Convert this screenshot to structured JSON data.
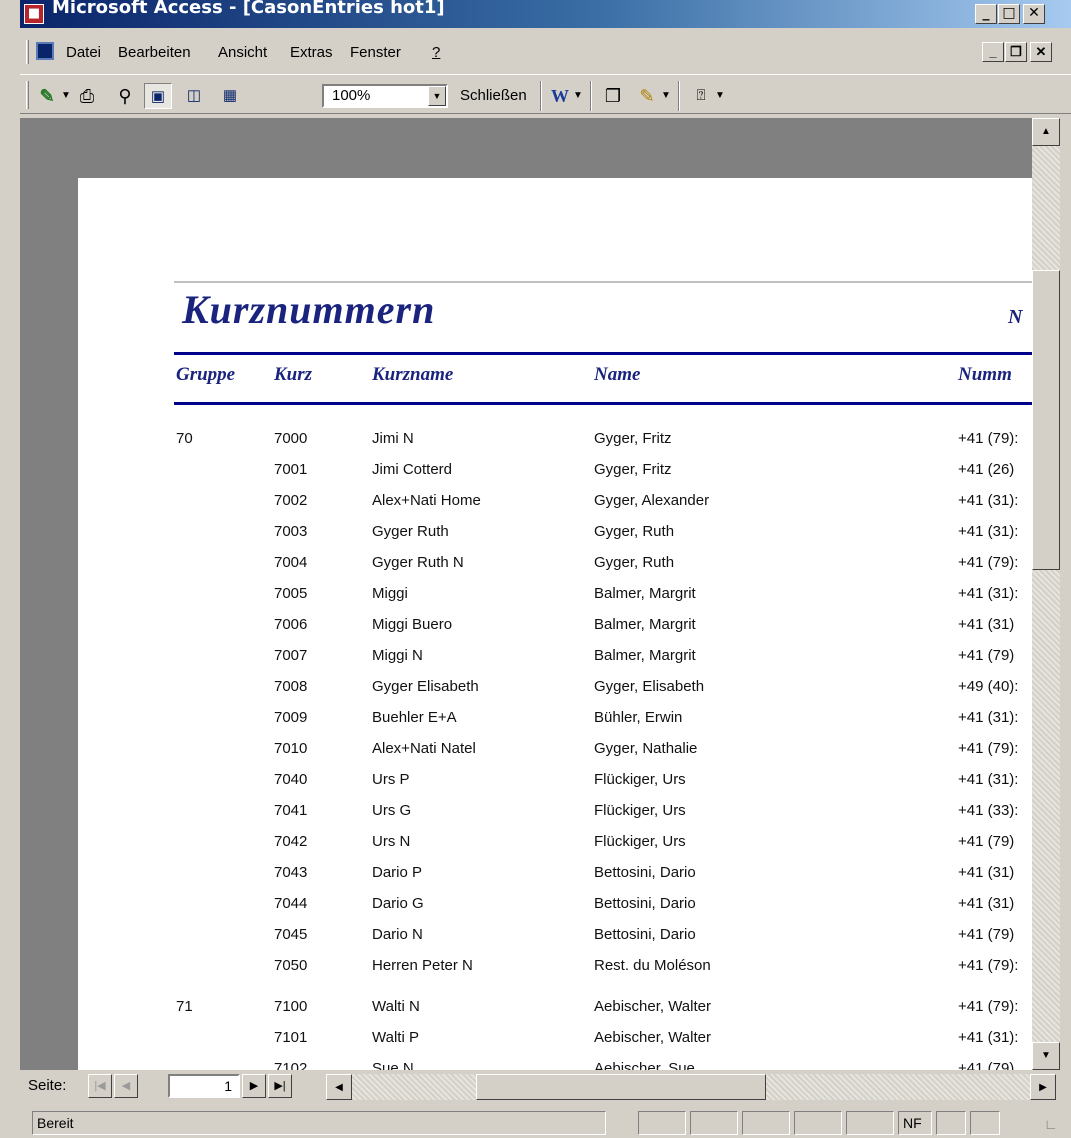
{
  "window": {
    "title": "Microsoft Access - [CasonEntries hot1]"
  },
  "menu": [
    "Datei",
    "Bearbeiten",
    "Ansicht",
    "Extras",
    "Fenster",
    "?"
  ],
  "toolbar": {
    "zoom": "100%",
    "close_label": "Schließen"
  },
  "report": {
    "title": "Kurznummern",
    "title_right": "N",
    "headers": {
      "gruppe": "Gruppe",
      "kurz": "Kurz",
      "kurzname": "Kurzname",
      "name": "Name",
      "nummer": "Numm"
    },
    "rows": [
      {
        "gruppe": "70",
        "kurz": "7000",
        "kurzname": "Jimi N",
        "name": "Gyger, Fritz",
        "nummer": "+41 (79):"
      },
      {
        "gruppe": "",
        "kurz": "7001",
        "kurzname": "Jimi Cotterd",
        "name": "Gyger, Fritz",
        "nummer": "+41 (26)"
      },
      {
        "gruppe": "",
        "kurz": "7002",
        "kurzname": "Alex+Nati Home",
        "name": "Gyger, Alexander",
        "nummer": "+41 (31):"
      },
      {
        "gruppe": "",
        "kurz": "7003",
        "kurzname": "Gyger Ruth",
        "name": "Gyger, Ruth",
        "nummer": "+41 (31):"
      },
      {
        "gruppe": "",
        "kurz": "7004",
        "kurzname": "Gyger Ruth N",
        "name": "Gyger, Ruth",
        "nummer": "+41 (79):"
      },
      {
        "gruppe": "",
        "kurz": "7005",
        "kurzname": "Miggi",
        "name": "Balmer, Margrit",
        "nummer": "+41 (31):"
      },
      {
        "gruppe": "",
        "kurz": "7006",
        "kurzname": "Miggi Buero",
        "name": "Balmer, Margrit",
        "nummer": "+41 (31)"
      },
      {
        "gruppe": "",
        "kurz": "7007",
        "kurzname": "Miggi N",
        "name": "Balmer, Margrit",
        "nummer": "+41 (79)"
      },
      {
        "gruppe": "",
        "kurz": "7008",
        "kurzname": "Gyger Elisabeth",
        "name": "Gyger, Elisabeth",
        "nummer": "+49 (40):"
      },
      {
        "gruppe": "",
        "kurz": "7009",
        "kurzname": "Buehler E+A",
        "name": "Bühler, Erwin",
        "nummer": "+41 (31):"
      },
      {
        "gruppe": "",
        "kurz": "7010",
        "kurzname": "Alex+Nati Natel",
        "name": "Gyger, Nathalie",
        "nummer": "+41 (79):"
      },
      {
        "gruppe": "",
        "kurz": "7040",
        "kurzname": "Urs P",
        "name": "Flückiger, Urs",
        "nummer": "+41 (31):"
      },
      {
        "gruppe": "",
        "kurz": "7041",
        "kurzname": "Urs G",
        "name": "Flückiger, Urs",
        "nummer": "+41 (33):"
      },
      {
        "gruppe": "",
        "kurz": "7042",
        "kurzname": "Urs N",
        "name": "Flückiger, Urs",
        "nummer": "+41 (79)"
      },
      {
        "gruppe": "",
        "kurz": "7043",
        "kurzname": "Dario P",
        "name": "Bettosini, Dario",
        "nummer": "+41 (31)"
      },
      {
        "gruppe": "",
        "kurz": "7044",
        "kurzname": "Dario G",
        "name": "Bettosini, Dario",
        "nummer": "+41 (31)"
      },
      {
        "gruppe": "",
        "kurz": "7045",
        "kurzname": "Dario N",
        "name": "Bettosini, Dario",
        "nummer": "+41 (79)"
      },
      {
        "gruppe": "",
        "kurz": "7050",
        "kurzname": "Herren Peter N",
        "name": "Rest. du Moléson",
        "nummer": "+41 (79):"
      },
      {
        "gruppe": "71",
        "kurz": "7100",
        "kurzname": "Walti N",
        "name": "Aebischer, Walter",
        "nummer": "+41 (79):"
      },
      {
        "gruppe": "",
        "kurz": "7101",
        "kurzname": "Walti P",
        "name": "Aebischer, Walter",
        "nummer": "+41 (31):"
      },
      {
        "gruppe": "",
        "kurz": "7102",
        "kurzname": "Sue N",
        "name": "Aebischer, Sue",
        "nummer": "+41 (79)"
      }
    ]
  },
  "nav": {
    "label": "Seite:",
    "page": "1"
  },
  "status": {
    "text": "Bereit",
    "nf": "NF"
  }
}
